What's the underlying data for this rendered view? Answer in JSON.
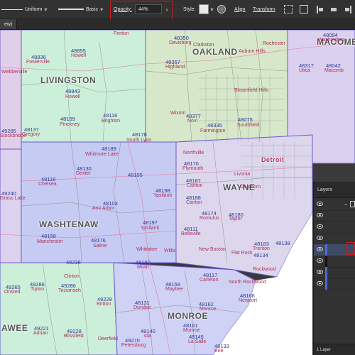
{
  "control_bar": {
    "stroke_profile_label": "Uniform",
    "brush_label": "Basic",
    "opacity_label": "Opacity:",
    "opacity_value": "44%",
    "style_label": "Style:",
    "align_label": "Align",
    "transform_label": "Transform"
  },
  "document_tab": {
    "label": "ew)"
  },
  "map": {
    "counties": [
      "OAKLAND",
      "MACOMB",
      "LIVINGSTON",
      "WASHTENAW",
      "WAYNE",
      "MONROE",
      "AWEE"
    ],
    "zips": [
      {
        "zip": "48836",
        "city": "Fowlerville"
      },
      {
        "zip": "48855",
        "city": "Howell"
      },
      {
        "zip": "48843",
        "city": "Howell"
      },
      {
        "zip": "48116",
        "city": "Brighton"
      },
      {
        "zip": "48169",
        "city": "Pinckney"
      },
      {
        "zip": "48137",
        "city": "Gregory"
      },
      {
        "zip": "48178",
        "city": "South Lyon"
      },
      {
        "zip": "48189",
        "city": "Whitmore Lake"
      },
      {
        "zip": "48130",
        "city": "Dexter"
      },
      {
        "zip": "48105",
        "city": ""
      },
      {
        "zip": "48118",
        "city": "Chelsea"
      },
      {
        "zip": "48103",
        "city": "Ann Arbor"
      },
      {
        "zip": "48198",
        "city": "Ypsilanti"
      },
      {
        "zip": "48197",
        "city": "Ypsilanti"
      },
      {
        "zip": "48158",
        "city": "Manchester"
      },
      {
        "zip": "48176",
        "city": "Saline"
      },
      {
        "zip": "48111",
        "city": "Belleville"
      },
      {
        "zip": "48160",
        "city": "Milan"
      },
      {
        "zip": "48236",
        "city": ""
      },
      {
        "zip": "49265",
        "city": "Onsted"
      },
      {
        "zip": "49286",
        "city": "Tipton"
      },
      {
        "zip": "49286",
        "city": "Tecumseh"
      },
      {
        "zip": "49229",
        "city": "Britton"
      },
      {
        "zip": "48117",
        "city": "Carleton"
      },
      {
        "zip": "48159",
        "city": "Maybee"
      },
      {
        "zip": "48131",
        "city": "Dundee"
      },
      {
        "zip": "48162",
        "city": "Monroe"
      },
      {
        "zip": "48166",
        "city": "Newport"
      },
      {
        "zip": "49221",
        "city": "Adrian"
      },
      {
        "zip": "49228",
        "city": "Blissfield"
      },
      {
        "zip": "48140",
        "city": "Ida"
      },
      {
        "zip": "48161",
        "city": "Monroe"
      },
      {
        "zip": "48145",
        "city": "La Salle"
      },
      {
        "zip": "48133",
        "city": "Erie"
      },
      {
        "zip": "49270",
        "city": "Petersburg"
      },
      {
        "zip": "48138",
        "city": ""
      },
      {
        "zip": "48134",
        "city": ""
      },
      {
        "zip": "48183",
        "city": "Trenton"
      },
      {
        "zip": "48180",
        "city": "Taylor"
      },
      {
        "zip": "48174",
        "city": "Romulus"
      },
      {
        "zip": "48170",
        "city": "Plymouth"
      },
      {
        "zip": "48187",
        "city": "Canton"
      },
      {
        "zip": "48188",
        "city": "Canton"
      },
      {
        "zip": "49240",
        "city": "Grass Lake"
      },
      {
        "zip": "49285",
        "city": "Stockbridge"
      },
      {
        "zip": "48377",
        "city": "Novi"
      },
      {
        "zip": "48335",
        "city": "Farmington"
      },
      {
        "zip": "48075",
        "city": "Southfield"
      },
      {
        "zip": "48357",
        "city": "Highland"
      },
      {
        "zip": "48350",
        "city": "Davisburg"
      },
      {
        "zip": "48317",
        "city": "Utica"
      },
      {
        "zip": "48042",
        "city": "Macomb"
      },
      {
        "zip": "48094",
        "city": "Washington"
      }
    ],
    "place_names": [
      "Fenton",
      "Davisburg",
      "Clarkston",
      "Auburn Hills",
      "Rochester",
      "Bloomfield Hills",
      "Detroit",
      "Wixom",
      "New Boston",
      "Flat Rock",
      "Rockwood",
      "South Rockwood",
      "Whittaker",
      "Willis",
      "Northville",
      "Livonia",
      "Dearborn",
      "Utica",
      "Macomb",
      "Webberville",
      "Stockbridge",
      "Grass Lake",
      "Clinton",
      "Deerfield"
    ]
  },
  "layers_panel": {
    "title": "Layers",
    "footer": "1 Layer",
    "row_count": 8
  }
}
